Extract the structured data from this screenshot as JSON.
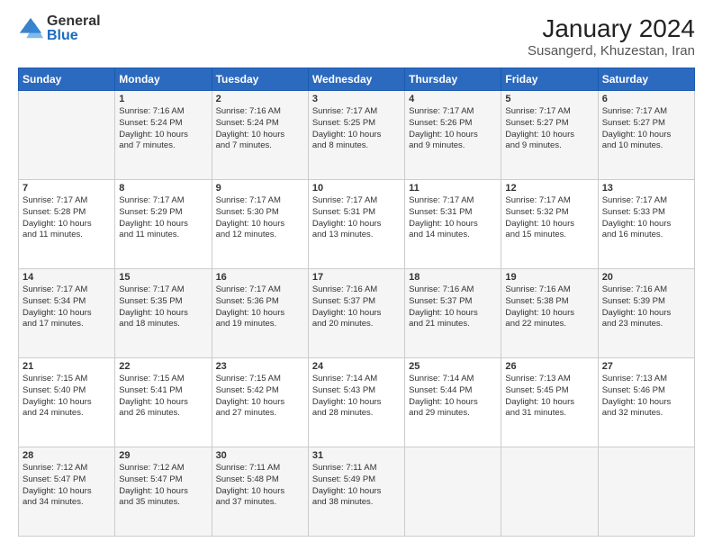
{
  "logo": {
    "general": "General",
    "blue": "Blue"
  },
  "title": "January 2024",
  "subtitle": "Susangerd, Khuzestan, Iran",
  "headers": [
    "Sunday",
    "Monday",
    "Tuesday",
    "Wednesday",
    "Thursday",
    "Friday",
    "Saturday"
  ],
  "weeks": [
    [
      {
        "day": "",
        "info": ""
      },
      {
        "day": "1",
        "info": "Sunrise: 7:16 AM\nSunset: 5:24 PM\nDaylight: 10 hours\nand 7 minutes."
      },
      {
        "day": "2",
        "info": "Sunrise: 7:16 AM\nSunset: 5:24 PM\nDaylight: 10 hours\nand 7 minutes."
      },
      {
        "day": "3",
        "info": "Sunrise: 7:17 AM\nSunset: 5:25 PM\nDaylight: 10 hours\nand 8 minutes."
      },
      {
        "day": "4",
        "info": "Sunrise: 7:17 AM\nSunset: 5:26 PM\nDaylight: 10 hours\nand 9 minutes."
      },
      {
        "day": "5",
        "info": "Sunrise: 7:17 AM\nSunset: 5:27 PM\nDaylight: 10 hours\nand 9 minutes."
      },
      {
        "day": "6",
        "info": "Sunrise: 7:17 AM\nSunset: 5:27 PM\nDaylight: 10 hours\nand 10 minutes."
      }
    ],
    [
      {
        "day": "7",
        "info": "Sunrise: 7:17 AM\nSunset: 5:28 PM\nDaylight: 10 hours\nand 11 minutes."
      },
      {
        "day": "8",
        "info": "Sunrise: 7:17 AM\nSunset: 5:29 PM\nDaylight: 10 hours\nand 11 minutes."
      },
      {
        "day": "9",
        "info": "Sunrise: 7:17 AM\nSunset: 5:30 PM\nDaylight: 10 hours\nand 12 minutes."
      },
      {
        "day": "10",
        "info": "Sunrise: 7:17 AM\nSunset: 5:31 PM\nDaylight: 10 hours\nand 13 minutes."
      },
      {
        "day": "11",
        "info": "Sunrise: 7:17 AM\nSunset: 5:31 PM\nDaylight: 10 hours\nand 14 minutes."
      },
      {
        "day": "12",
        "info": "Sunrise: 7:17 AM\nSunset: 5:32 PM\nDaylight: 10 hours\nand 15 minutes."
      },
      {
        "day": "13",
        "info": "Sunrise: 7:17 AM\nSunset: 5:33 PM\nDaylight: 10 hours\nand 16 minutes."
      }
    ],
    [
      {
        "day": "14",
        "info": "Sunrise: 7:17 AM\nSunset: 5:34 PM\nDaylight: 10 hours\nand 17 minutes."
      },
      {
        "day": "15",
        "info": "Sunrise: 7:17 AM\nSunset: 5:35 PM\nDaylight: 10 hours\nand 18 minutes."
      },
      {
        "day": "16",
        "info": "Sunrise: 7:17 AM\nSunset: 5:36 PM\nDaylight: 10 hours\nand 19 minutes."
      },
      {
        "day": "17",
        "info": "Sunrise: 7:16 AM\nSunset: 5:37 PM\nDaylight: 10 hours\nand 20 minutes."
      },
      {
        "day": "18",
        "info": "Sunrise: 7:16 AM\nSunset: 5:37 PM\nDaylight: 10 hours\nand 21 minutes."
      },
      {
        "day": "19",
        "info": "Sunrise: 7:16 AM\nSunset: 5:38 PM\nDaylight: 10 hours\nand 22 minutes."
      },
      {
        "day": "20",
        "info": "Sunrise: 7:16 AM\nSunset: 5:39 PM\nDaylight: 10 hours\nand 23 minutes."
      }
    ],
    [
      {
        "day": "21",
        "info": "Sunrise: 7:15 AM\nSunset: 5:40 PM\nDaylight: 10 hours\nand 24 minutes."
      },
      {
        "day": "22",
        "info": "Sunrise: 7:15 AM\nSunset: 5:41 PM\nDaylight: 10 hours\nand 26 minutes."
      },
      {
        "day": "23",
        "info": "Sunrise: 7:15 AM\nSunset: 5:42 PM\nDaylight: 10 hours\nand 27 minutes."
      },
      {
        "day": "24",
        "info": "Sunrise: 7:14 AM\nSunset: 5:43 PM\nDaylight: 10 hours\nand 28 minutes."
      },
      {
        "day": "25",
        "info": "Sunrise: 7:14 AM\nSunset: 5:44 PM\nDaylight: 10 hours\nand 29 minutes."
      },
      {
        "day": "26",
        "info": "Sunrise: 7:13 AM\nSunset: 5:45 PM\nDaylight: 10 hours\nand 31 minutes."
      },
      {
        "day": "27",
        "info": "Sunrise: 7:13 AM\nSunset: 5:46 PM\nDaylight: 10 hours\nand 32 minutes."
      }
    ],
    [
      {
        "day": "28",
        "info": "Sunrise: 7:12 AM\nSunset: 5:47 PM\nDaylight: 10 hours\nand 34 minutes."
      },
      {
        "day": "29",
        "info": "Sunrise: 7:12 AM\nSunset: 5:47 PM\nDaylight: 10 hours\nand 35 minutes."
      },
      {
        "day": "30",
        "info": "Sunrise: 7:11 AM\nSunset: 5:48 PM\nDaylight: 10 hours\nand 37 minutes."
      },
      {
        "day": "31",
        "info": "Sunrise: 7:11 AM\nSunset: 5:49 PM\nDaylight: 10 hours\nand 38 minutes."
      },
      {
        "day": "",
        "info": ""
      },
      {
        "day": "",
        "info": ""
      },
      {
        "day": "",
        "info": ""
      }
    ]
  ]
}
